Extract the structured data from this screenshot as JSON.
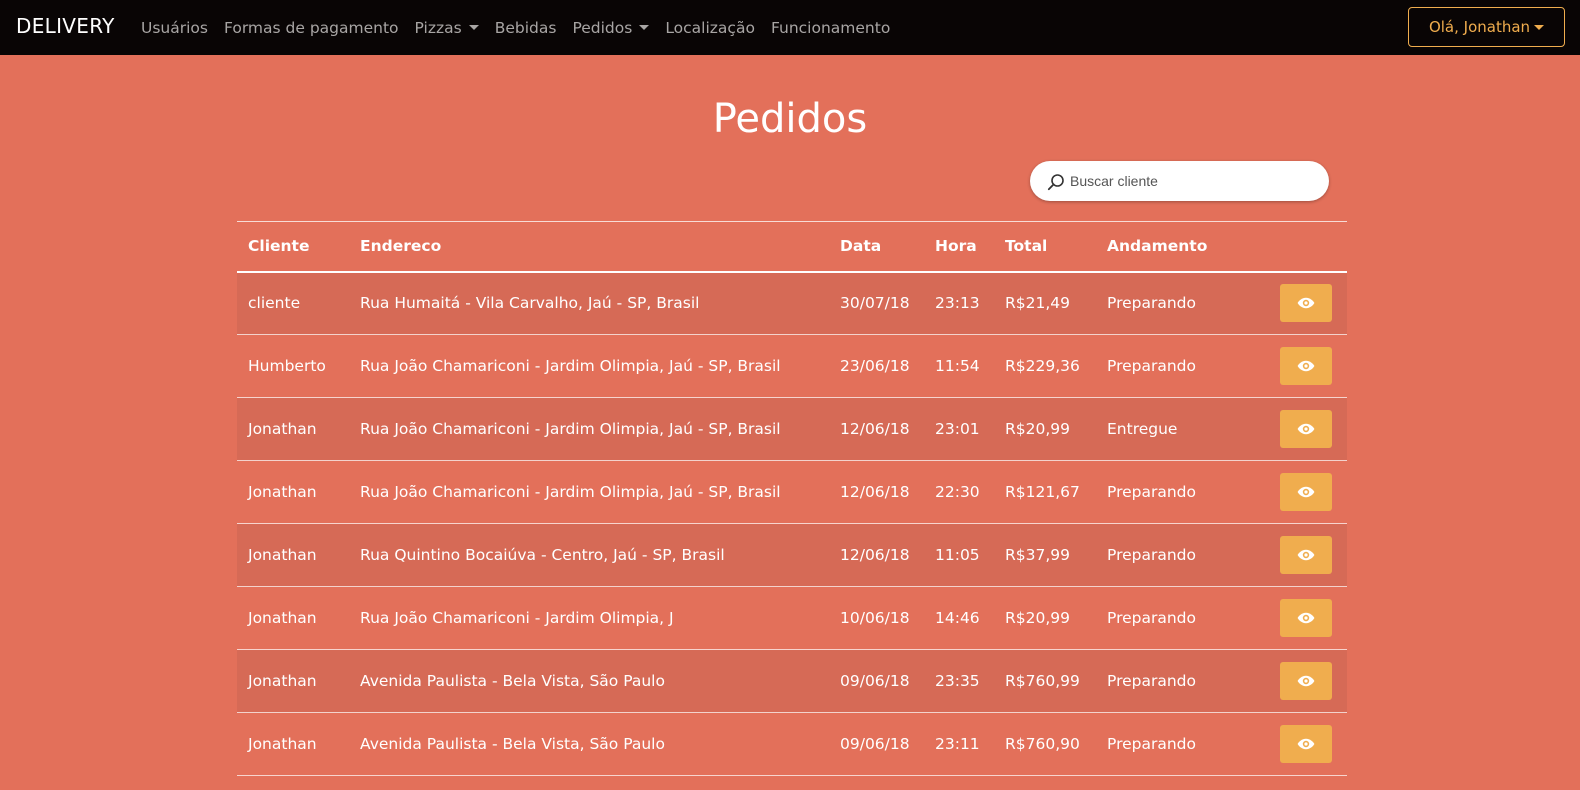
{
  "navbar": {
    "brand": "DELIVERY",
    "items": [
      {
        "label": "Usuários",
        "dropdown": false
      },
      {
        "label": "Formas de pagamento",
        "dropdown": false
      },
      {
        "label": "Pizzas",
        "dropdown": true
      },
      {
        "label": "Bebidas",
        "dropdown": false
      },
      {
        "label": "Pedidos",
        "dropdown": true
      },
      {
        "label": "Localização",
        "dropdown": false
      },
      {
        "label": "Funcionamento",
        "dropdown": false
      }
    ],
    "user_menu_label": "Olá, Jonathan"
  },
  "page": {
    "title": "Pedidos"
  },
  "search": {
    "placeholder": "Buscar cliente",
    "value": ""
  },
  "table": {
    "headers": [
      "Cliente",
      "Endereco",
      "Data",
      "Hora",
      "Total",
      "Andamento"
    ],
    "rows": [
      {
        "cliente": "cliente",
        "endereco": "Rua Humaitá - Vila Carvalho, Jaú - SP, Brasil",
        "data": "30/07/18",
        "hora": "23:13",
        "total": "R$21,49",
        "andamento": "Preparando"
      },
      {
        "cliente": "Humberto",
        "endereco": "Rua João Chamariconi - Jardim Olimpia, Jaú - SP, Brasil",
        "data": "23/06/18",
        "hora": "11:54",
        "total": "R$229,36",
        "andamento": "Preparando"
      },
      {
        "cliente": "Jonathan",
        "endereco": "Rua João Chamariconi - Jardim Olimpia, Jaú - SP, Brasil",
        "data": "12/06/18",
        "hora": "23:01",
        "total": "R$20,99",
        "andamento": "Entregue"
      },
      {
        "cliente": "Jonathan",
        "endereco": "Rua João Chamariconi - Jardim Olimpia, Jaú - SP, Brasil",
        "data": "12/06/18",
        "hora": "22:30",
        "total": "R$121,67",
        "andamento": "Preparando"
      },
      {
        "cliente": "Jonathan",
        "endereco": "Rua Quintino Bocaiúva - Centro, Jaú - SP, Brasil",
        "data": "12/06/18",
        "hora": "11:05",
        "total": "R$37,99",
        "andamento": "Preparando"
      },
      {
        "cliente": "Jonathan",
        "endereco": "Rua João Chamariconi - Jardim Olimpia, J",
        "data": "10/06/18",
        "hora": "14:46",
        "total": "R$20,99",
        "andamento": "Preparando"
      },
      {
        "cliente": "Jonathan",
        "endereco": "Avenida Paulista - Bela Vista, São Paulo",
        "data": "09/06/18",
        "hora": "23:35",
        "total": "R$760,99",
        "andamento": "Preparando"
      },
      {
        "cliente": "Jonathan",
        "endereco": "Avenida Paulista - Bela Vista, São Paulo",
        "data": "09/06/18",
        "hora": "23:11",
        "total": "R$760,90",
        "andamento": "Preparando"
      }
    ],
    "action_icon": "eye-icon"
  },
  "colors": {
    "background": "#e3705a",
    "row_stripe": "#d66a56",
    "navbar": "#090505",
    "accent": "#f0ad4e"
  }
}
